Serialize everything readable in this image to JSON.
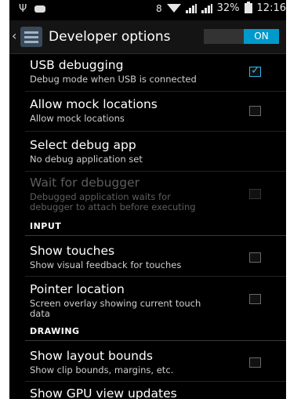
{
  "status_bar": {
    "battery_percent": "32%",
    "time": "12:16"
  },
  "action_bar": {
    "title": "Developer options",
    "toggle_label": "ON"
  },
  "settings": [
    {
      "title": "USB debugging",
      "summary": "Debug mode when USB is connected",
      "checked": true,
      "enabled": true
    },
    {
      "title": "Allow mock locations",
      "summary": "Allow mock locations",
      "checked": false,
      "enabled": true
    },
    {
      "title": "Select debug app",
      "summary": "No debug application set",
      "enabled": true
    },
    {
      "title": "Wait for debugger",
      "summary_line1": "Debugged application waits for",
      "summary_line2": "debugger to attach before executing",
      "checked": false,
      "enabled": false
    }
  ],
  "sections": {
    "input": "INPUT",
    "drawing": "DRAWING"
  },
  "input_settings": [
    {
      "title": "Show touches",
      "summary": "Show visual feedback for touches",
      "checked": false
    },
    {
      "title": "Pointer location",
      "summary_line1": "Screen overlay showing current touch",
      "summary_line2": "data",
      "checked": false
    }
  ],
  "drawing_settings": [
    {
      "title": "Show layout bounds",
      "summary": "Show clip bounds, margins, etc.",
      "checked": false
    },
    {
      "title": "Show GPU view updates"
    }
  ]
}
